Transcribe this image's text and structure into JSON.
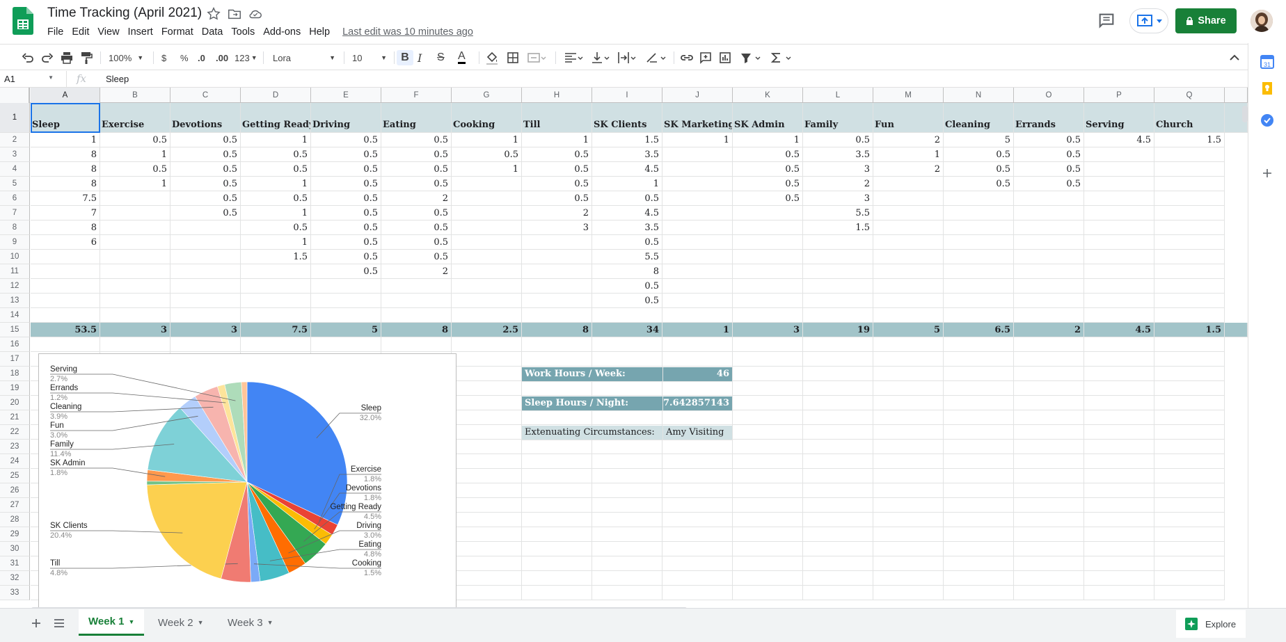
{
  "header": {
    "title": "Time Tracking (April 2021)",
    "menus": [
      "File",
      "Edit",
      "View",
      "Insert",
      "Format",
      "Data",
      "Tools",
      "Add-ons",
      "Help"
    ],
    "last_edit": "Last edit was 10 minutes ago",
    "share_label": "Share"
  },
  "toolbar": {
    "zoom": "100%",
    "currency": "$",
    "percent": "%",
    "dec_less": ".0",
    "dec_more": ".00",
    "format_more": "123",
    "font": "Lora",
    "font_size": "10"
  },
  "formula_bar": {
    "name_box": "A1",
    "fx": "fx",
    "value": "Sleep"
  },
  "columns": [
    "A",
    "B",
    "C",
    "D",
    "E",
    "F",
    "G",
    "H",
    "I",
    "J",
    "K",
    "L",
    "M",
    "N",
    "O",
    "P",
    "Q"
  ],
  "row_numbers": [
    "1",
    "2",
    "3",
    "4",
    "5",
    "6",
    "7",
    "8",
    "9",
    "10",
    "11",
    "12",
    "13",
    "14",
    "15",
    "16",
    "17",
    "18",
    "19",
    "20",
    "21",
    "22",
    "23",
    "24",
    "25",
    "26",
    "27",
    "28",
    "29",
    "30",
    "31",
    "32",
    "33"
  ],
  "headers": [
    "Sleep",
    "Exercise",
    "Devotions",
    "Getting Ready",
    "Driving",
    "Eating",
    "Cooking",
    "Till",
    "SK Clients",
    "SK Marketing",
    "SK Admin",
    "Family",
    "Fun",
    "Cleaning",
    "Errands",
    "Serving",
    "Church"
  ],
  "rows": [
    [
      "1",
      "0.5",
      "0.5",
      "1",
      "0.5",
      "0.5",
      "1",
      "1",
      "1.5",
      "1",
      "1",
      "0.5",
      "2",
      "5",
      "0.5",
      "4.5",
      "1.5"
    ],
    [
      "8",
      "1",
      "0.5",
      "0.5",
      "0.5",
      "0.5",
      "0.5",
      "0.5",
      "3.5",
      "",
      "0.5",
      "3.5",
      "1",
      "0.5",
      "0.5",
      "",
      ""
    ],
    [
      "8",
      "0.5",
      "0.5",
      "0.5",
      "0.5",
      "0.5",
      "1",
      "0.5",
      "4.5",
      "",
      "0.5",
      "3",
      "2",
      "0.5",
      "0.5",
      "",
      ""
    ],
    [
      "8",
      "1",
      "0.5",
      "1",
      "0.5",
      "0.5",
      "",
      "0.5",
      "1",
      "",
      "0.5",
      "2",
      "",
      "0.5",
      "0.5",
      "",
      ""
    ],
    [
      "7.5",
      "",
      "0.5",
      "0.5",
      "0.5",
      "2",
      "",
      "0.5",
      "0.5",
      "",
      "0.5",
      "3",
      "",
      "",
      "",
      "",
      ""
    ],
    [
      "7",
      "",
      "0.5",
      "1",
      "0.5",
      "0.5",
      "",
      "2",
      "4.5",
      "",
      "",
      "5.5",
      "",
      "",
      "",
      "",
      ""
    ],
    [
      "8",
      "",
      "",
      "0.5",
      "0.5",
      "0.5",
      "",
      "3",
      "3.5",
      "",
      "",
      "1.5",
      "",
      "",
      "",
      "",
      ""
    ],
    [
      "6",
      "",
      "",
      "1",
      "0.5",
      "0.5",
      "",
      "",
      "0.5",
      "",
      "",
      "",
      "",
      "",
      "",
      "",
      ""
    ],
    [
      "",
      "",
      "",
      "1.5",
      "0.5",
      "0.5",
      "",
      "",
      "5.5",
      "",
      "",
      "",
      "",
      "",
      "",
      "",
      ""
    ],
    [
      "",
      "",
      "",
      "",
      "0.5",
      "2",
      "",
      "",
      "8",
      "",
      "",
      "",
      "",
      "",
      "",
      "",
      ""
    ],
    [
      "",
      "",
      "",
      "",
      "",
      "",
      "",
      "",
      "0.5",
      "",
      "",
      "",
      "",
      "",
      "",
      "",
      ""
    ],
    [
      "",
      "",
      "",
      "",
      "",
      "",
      "",
      "",
      "0.5",
      "",
      "",
      "",
      "",
      "",
      "",
      "",
      ""
    ]
  ],
  "totals": [
    "53.5",
    "3",
    "3",
    "7.5",
    "5",
    "8",
    "2.5",
    "8",
    "34",
    "1",
    "3",
    "19",
    "5",
    "6.5",
    "2",
    "4.5",
    "1.5"
  ],
  "summary": {
    "work_label": "Work Hours / Week:",
    "work_value": "46",
    "sleep_label": "Sleep Hours / Night:",
    "sleep_value": "7.642857143",
    "extenuating_label": "Extenuating Circumstances:",
    "extenuating_value": "Amy Visiting"
  },
  "chart_data": {
    "type": "pie",
    "title": "",
    "series": [
      {
        "name": "Sleep",
        "value": 53.5,
        "label": "32.0%",
        "color": "#4285f4"
      },
      {
        "name": "Exercise",
        "value": 3,
        "label": "1.8%",
        "color": "#ea4335"
      },
      {
        "name": "Devotions",
        "value": 3,
        "label": "1.8%",
        "color": "#fbbc04"
      },
      {
        "name": "Getting Ready",
        "value": 7.5,
        "label": "4.5%",
        "color": "#34a853"
      },
      {
        "name": "Driving",
        "value": 5,
        "label": "3.0%",
        "color": "#ff6d01"
      },
      {
        "name": "Eating",
        "value": 8,
        "label": "4.8%",
        "color": "#46bdc6"
      },
      {
        "name": "Cooking",
        "value": 2.5,
        "label": "1.5%",
        "color": "#7baaf7"
      },
      {
        "name": "Till",
        "value": 8,
        "label": "4.8%",
        "color": "#f07b72"
      },
      {
        "name": "SK Clients",
        "value": 34,
        "label": "20.4%",
        "color": "#fcd04f"
      },
      {
        "name": "SK Marketing",
        "value": 1,
        "label": "",
        "color": "#71c287"
      },
      {
        "name": "SK Admin",
        "value": 3,
        "label": "1.8%",
        "color": "#ff994d"
      },
      {
        "name": "Family",
        "value": 19,
        "label": "11.4%",
        "color": "#7ed1d7"
      },
      {
        "name": "Fun",
        "value": 5,
        "label": "3.0%",
        "color": "#b3cefb"
      },
      {
        "name": "Cleaning",
        "value": 6.5,
        "label": "3.9%",
        "color": "#f7b4ae"
      },
      {
        "name": "Errands",
        "value": 2,
        "label": "1.2%",
        "color": "#fde49b"
      },
      {
        "name": "Serving",
        "value": 4.5,
        "label": "2.7%",
        "color": "#aedcba"
      },
      {
        "name": "Church",
        "value": 1.5,
        "label": "",
        "color": "#ffc599"
      }
    ]
  },
  "sheets": [
    "Week 1",
    "Week 2",
    "Week 3"
  ],
  "explore_label": "Explore"
}
